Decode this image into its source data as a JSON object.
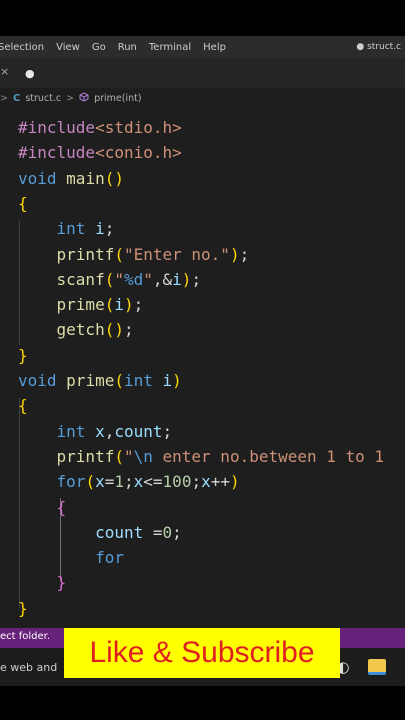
{
  "menubar": {
    "items": [
      "Selection",
      "View",
      "Go",
      "Run",
      "Terminal",
      "Help"
    ],
    "window_title": "● struct.c"
  },
  "tabbar": {
    "modified_dot": "●",
    "close_glyph": "×"
  },
  "breadcrumb": {
    "file_icon": "C",
    "file": "struct.c",
    "separator": ">",
    "symbol_icon": "cube-icon",
    "symbol": "prime(int)"
  },
  "editor": {
    "language": "c",
    "lines": [
      "#include<stdio.h>",
      "#include<conio.h>",
      "void main()",
      "{",
      "    int i;",
      "    printf(\"Enter no.\");",
      "    scanf(\"%d\",&i);",
      "    prime(i);",
      "    getch();",
      "}",
      "void prime(int i)",
      "{",
      "    int x,count;",
      "    printf(\"\\n enter no.between 1 to 1",
      "    for(x=1;x<=100;x++)",
      "    {",
      "        count =0;",
      "        for",
      "    }",
      "}"
    ]
  },
  "statusbar": {
    "text": "ect folder."
  },
  "taskbar": {
    "search_text": "e web and"
  },
  "overlay": {
    "banner_text": "Like & Subscribe"
  },
  "colors": {
    "editor_bg": "#1e1e1e",
    "keyword": "#569cd6",
    "function": "#dcdcaa",
    "string": "#ce9178",
    "status_bar": "#68217a",
    "banner_bg": "#ffff00",
    "banner_text": "#e02020"
  }
}
